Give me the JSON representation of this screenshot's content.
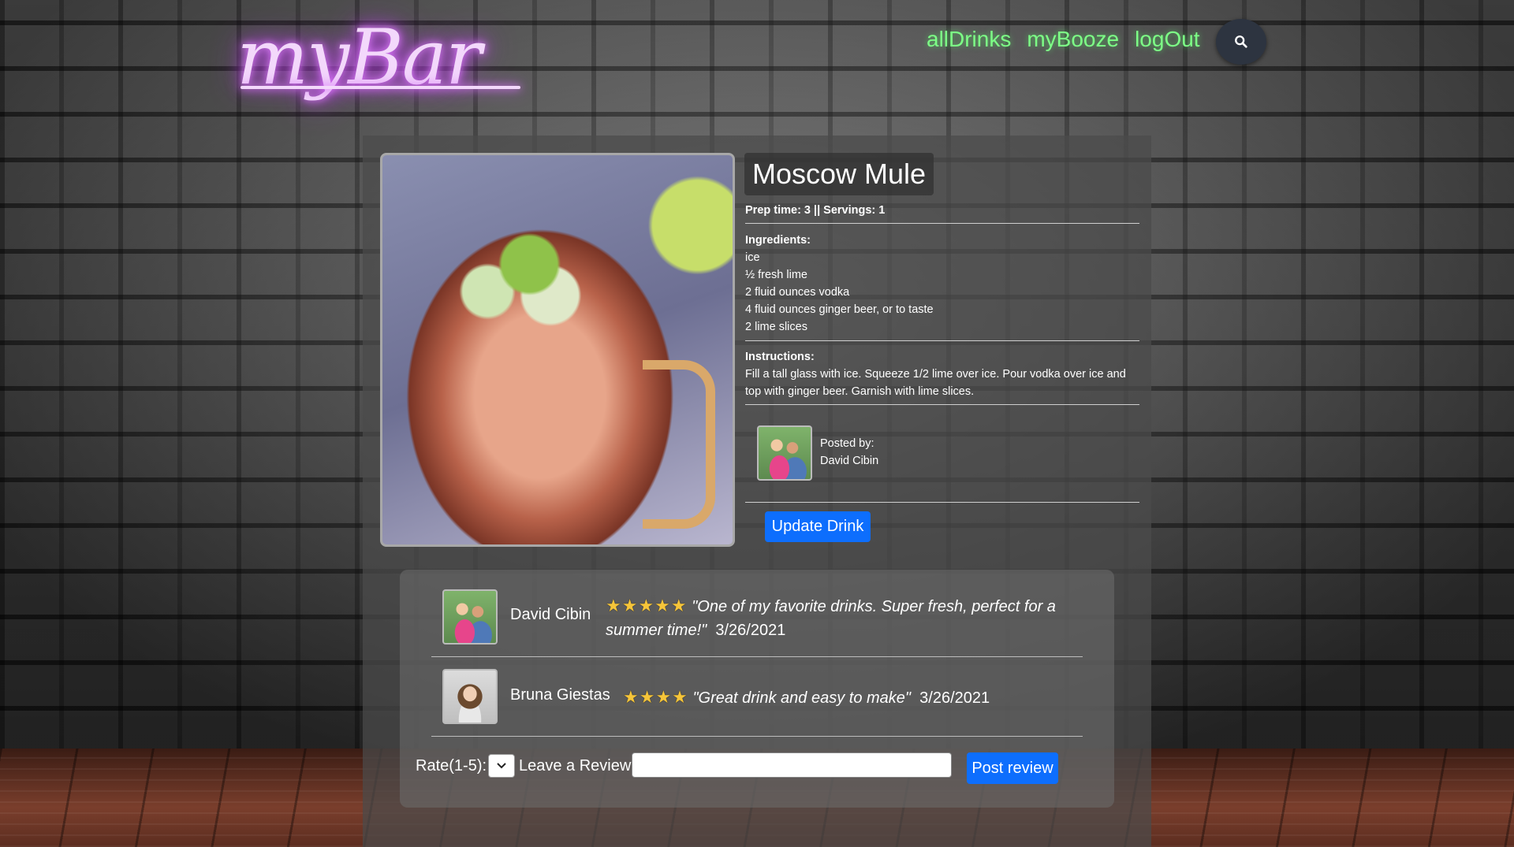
{
  "header": {
    "logo_text": "myBar",
    "nav": [
      "allDrinks",
      "myBooze",
      "logOut"
    ]
  },
  "drink": {
    "name": "Moscow Mule",
    "prep_line": "Prep time: 3 || Servings: 1",
    "ingredients_label": "Ingredients:",
    "ingredients": [
      "ice",
      "½ fresh lime",
      "2 fluid ounces vodka",
      "4 fluid ounces ginger beer, or to taste",
      "2 lime slices"
    ],
    "instructions_label": "Instructions:",
    "instructions": "Fill a tall glass with ice. Squeeze 1/2 lime over ice. Pour vodka over ice and top with ginger beer. Garnish with lime slices.",
    "posted_by_label": "Posted by:",
    "posted_by": "David Cibin",
    "update_button": "Update Drink"
  },
  "reviews": [
    {
      "name": "David Cibin",
      "stars": "★★★★★",
      "rating": 5,
      "text": "\"One of my favorite drinks. Super fresh, perfect for a summer time!\"",
      "date": "3/26/2021"
    },
    {
      "name": "Bruna Giestas",
      "stars": "★★★★",
      "rating": 4,
      "text": "\"Great drink and easy to make\"",
      "date": "3/26/2021"
    }
  ],
  "review_form": {
    "rate_label": "Rate(1-5):",
    "review_label": "Leave a Review:",
    "review_value": "",
    "post_button": "Post review"
  },
  "colors": {
    "nav_link": "#7dff86",
    "button": "#0d6efd",
    "logo_glow": "#e07cff",
    "star": "#f6c53a"
  }
}
